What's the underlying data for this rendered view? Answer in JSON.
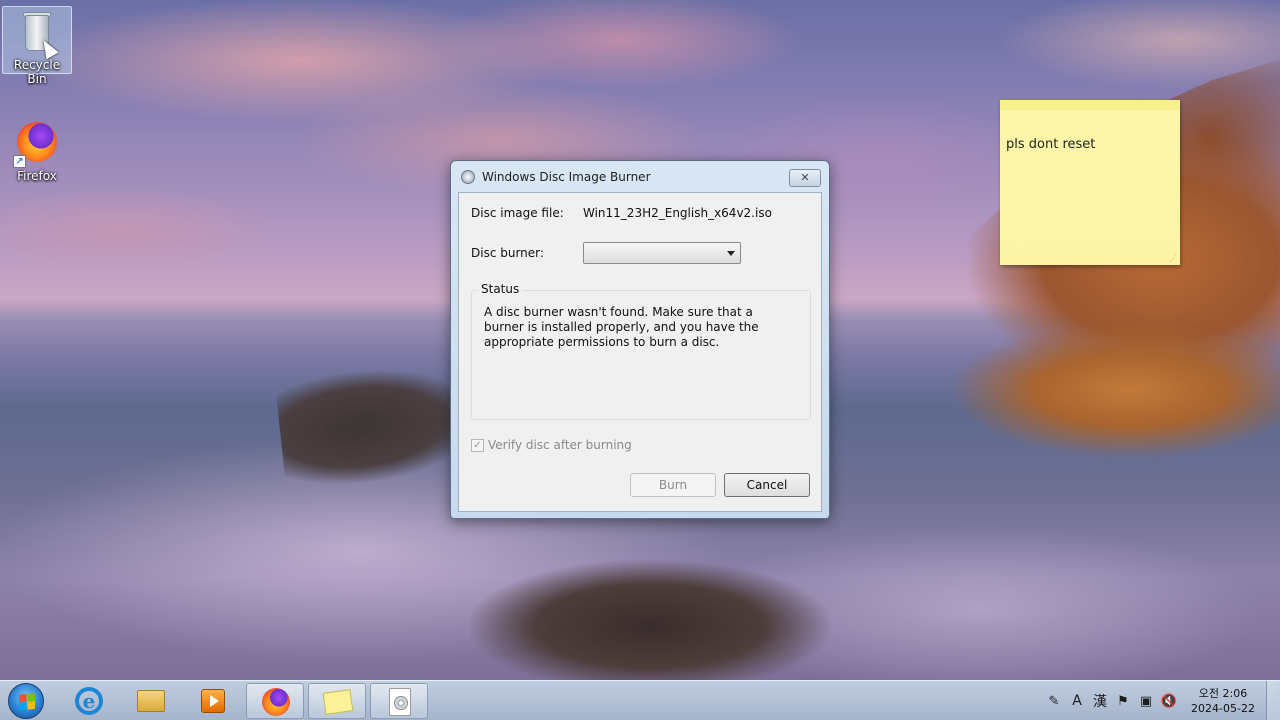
{
  "desktop": {
    "icons": [
      {
        "label": "Recycle Bin",
        "icon": "recycle-bin-icon"
      },
      {
        "label": "Firefox",
        "icon": "firefox-icon"
      }
    ]
  },
  "sticky_note": {
    "text": "pls dont reset"
  },
  "dialog": {
    "title": "Windows Disc Image Burner",
    "close_glyph": "✕",
    "disc_image_label": "Disc image file:",
    "disc_image_value": "Win11_23H2_English_x64v2.iso",
    "disc_burner_label": "Disc burner:",
    "disc_burner_selected": "",
    "status_title": "Status",
    "status_text": "A disc burner wasn't found. Make sure that a burner is installed properly, and you have the appropriate permissions to burn a disc.",
    "verify_label": "Verify disc after burning",
    "verify_checked": true,
    "burn_label": "Burn",
    "cancel_label": "Cancel"
  },
  "taskbar": {
    "pinned": [
      {
        "name": "internet-explorer-icon"
      },
      {
        "name": "file-explorer-icon"
      },
      {
        "name": "media-player-icon"
      },
      {
        "name": "firefox-icon"
      },
      {
        "name": "sticky-notes-icon"
      },
      {
        "name": "disc-image-burner-icon"
      }
    ],
    "tray": {
      "ime_mode": "A",
      "ime_hanja": "漢",
      "clock_time": "오전 2:06",
      "clock_date": "2024-05-22"
    }
  },
  "colors": {
    "taskbar": "#b4c4d8",
    "sticky": "#fcf3a5",
    "dialog_frame": "#c7d9ee"
  }
}
